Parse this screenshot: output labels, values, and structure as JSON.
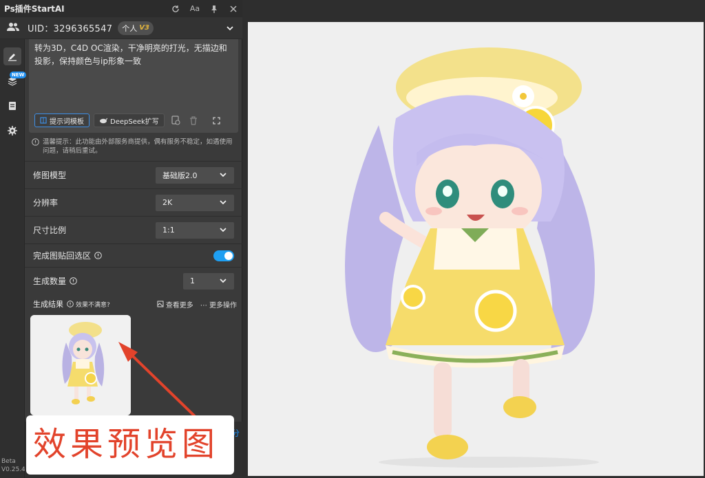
{
  "window": {
    "title": "Ps插件StartAI"
  },
  "titlebar_icons": [
    "refresh-icon",
    "font-size-icon",
    "pin-icon",
    "close-icon"
  ],
  "titlebar": {
    "font_label": "Aa"
  },
  "user": {
    "uid_label": "UID：3296365547",
    "plan": "个人",
    "level": "V3"
  },
  "sidebar": {
    "new_tag": "NEW",
    "version_line1": "Beta",
    "version_line2": "V0.25.4"
  },
  "prompt": {
    "text": "转为3D，C4D OC渲染，干净明亮的打光，无描边和投影，保持颜色与ip形象一致",
    "template_button": "提示词模板",
    "deepseek_button": "DeepSeek扩写"
  },
  "tip": {
    "text": "温馨提示：此功能由外部服务商提供，偶有服务不稳定，如遇使用问题，请稍后重试。"
  },
  "settings": {
    "model_label": "修图模型",
    "model_value": "基础版2.0",
    "resolution_label": "分辨率",
    "resolution_value": "2K",
    "ratio_label": "尺寸比例",
    "ratio_value": "1:1",
    "paste_label": "完成图贴回选区",
    "paste_on": true,
    "count_label": "生成数量",
    "count_value": "1"
  },
  "results": {
    "label": "生成结果",
    "unsatisfied": "效果不满意?",
    "view_more": "查看更多",
    "more_actions": "更多操作"
  },
  "bottom": {
    "side_label": "分"
  },
  "annotation": {
    "text": "效果预览图",
    "color": "#e2432b"
  },
  "colors": {
    "accent": "#1a8cf0",
    "panel": "#3a3a3a",
    "canvas": "#efefef"
  }
}
